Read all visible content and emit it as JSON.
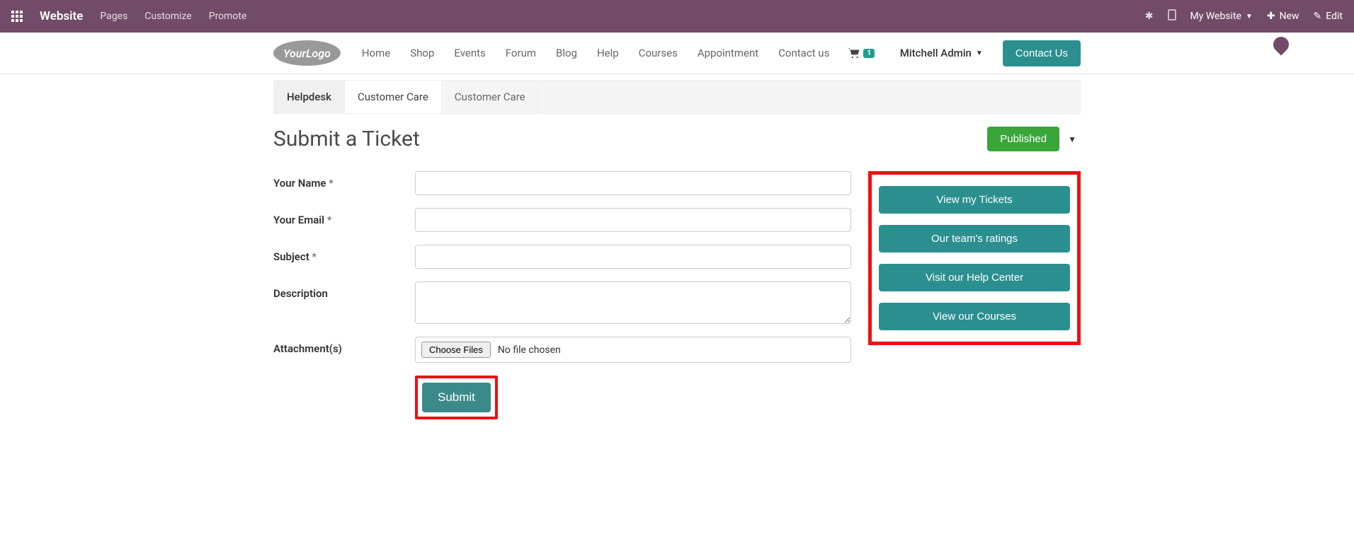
{
  "topbar": {
    "brand": "Website",
    "links": [
      "Pages",
      "Customize",
      "Promote"
    ],
    "my_website": "My Website",
    "new": "New",
    "edit": "Edit"
  },
  "sitenav": {
    "logo_text": "YourLogo",
    "items": [
      "Home",
      "Shop",
      "Events",
      "Forum",
      "Blog",
      "Help",
      "Courses",
      "Appointment",
      "Contact us"
    ],
    "cart_count": "1",
    "user": "Mitchell Admin",
    "contact": "Contact Us"
  },
  "breadcrumb": {
    "root": "Helpdesk",
    "active": "Customer Care",
    "trail": "Customer Care"
  },
  "page": {
    "title": "Submit a Ticket",
    "published": "Published"
  },
  "form": {
    "name_label": "Your Name",
    "email_label": "Your Email",
    "subject_label": "Subject",
    "desc_label": "Description",
    "attach_label": "Attachment(s)",
    "required": "*",
    "choose_files": "Choose Files",
    "no_file": "No file chosen",
    "submit": "Submit"
  },
  "sidebar": {
    "btn1": "View my Tickets",
    "btn2": "Our team's ratings",
    "btn3": "Visit our Help Center",
    "btn4": "View our Courses"
  }
}
